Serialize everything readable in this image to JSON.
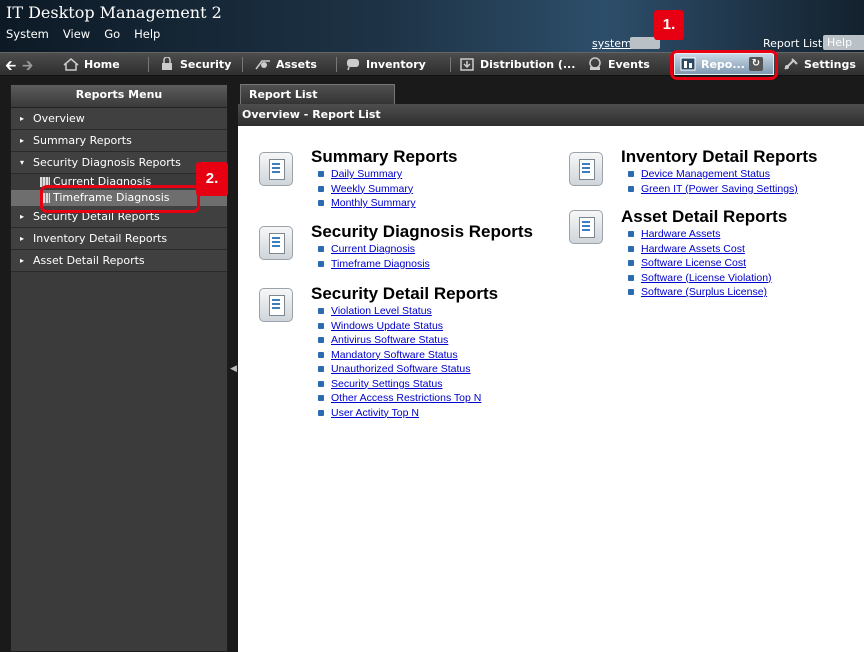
{
  "app": {
    "title": "IT Desktop Management 2"
  },
  "menubar": [
    "System",
    "View",
    "Go",
    "Help"
  ],
  "header": {
    "user": "system",
    "report_list_link": "Report List",
    "help": "Help"
  },
  "tabs": [
    {
      "label": "Home",
      "icon": "home-icon"
    },
    {
      "label": "Security",
      "icon": "lock-icon"
    },
    {
      "label": "Assets",
      "icon": "assets-icon"
    },
    {
      "label": "Inventory",
      "icon": "inventory-icon"
    },
    {
      "label": "Distribution (...",
      "icon": "distribution-icon"
    },
    {
      "label": "Events",
      "icon": "events-icon"
    },
    {
      "label": "Repo...",
      "icon": "reports-icon"
    },
    {
      "label": "Settings",
      "icon": "settings-icon"
    }
  ],
  "sidebar": {
    "title": "Reports Menu",
    "items": [
      "Overview",
      "Summary Reports",
      "Security Diagnosis Reports",
      "Security Detail Reports",
      "Inventory Detail Reports",
      "Asset Detail Reports"
    ],
    "sub_items": [
      "Current Diagnosis",
      "Timeframe Diagnosis"
    ]
  },
  "main": {
    "tab": "Report List",
    "breadcrumb": "Overview - Report List",
    "sections": [
      {
        "title": "Summary Reports",
        "links": [
          "Daily Summary",
          "Weekly Summary",
          "Monthly Summary"
        ]
      },
      {
        "title": "Security Diagnosis Reports",
        "links": [
          "Current Diagnosis",
          "Timeframe Diagnosis"
        ]
      },
      {
        "title": "Security Detail Reports",
        "links": [
          "Violation Level Status",
          "Windows Update Status",
          "Antivirus Software Status",
          "Mandatory Software Status",
          "Unauthorized Software Status",
          "Security Settings Status",
          "Other Access Restrictions Top N",
          "User Activity Top N"
        ]
      },
      {
        "title": "Inventory Detail Reports",
        "links": [
          "Device Management Status",
          "Green IT (Power Saving Settings)"
        ]
      },
      {
        "title": "Asset Detail Reports",
        "links": [
          "Hardware Assets",
          "Hardware Assets Cost",
          "Software License Cost",
          "Software (License Violation)",
          "Software (Surplus License)"
        ]
      }
    ]
  },
  "callouts": [
    "1.",
    "2."
  ],
  "colors": {
    "accent": "#e60012",
    "link": "#0000cc"
  }
}
